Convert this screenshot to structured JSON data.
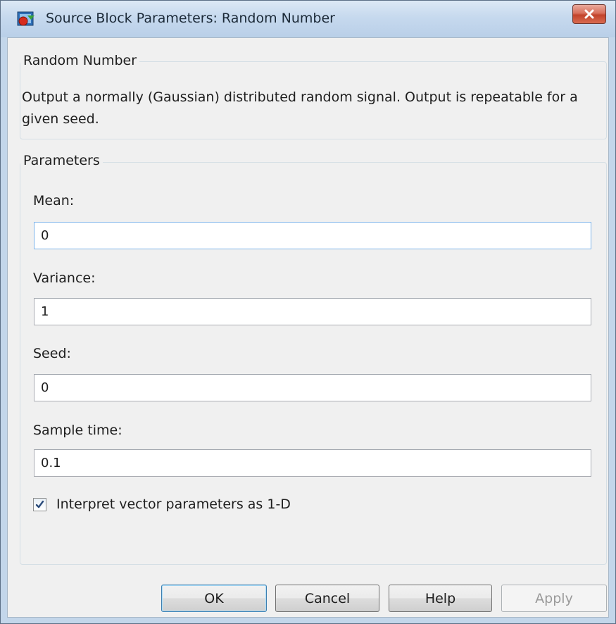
{
  "window": {
    "title": "Source Block Parameters: Random Number"
  },
  "description_group": {
    "title": "Random Number",
    "text": "Output a normally (Gaussian) distributed random signal.  Output is repeatable for a given seed."
  },
  "parameters_group": {
    "title": "Parameters",
    "fields": [
      {
        "label": "Mean:",
        "value": "0"
      },
      {
        "label": "Variance:",
        "value": "1"
      },
      {
        "label": "Seed:",
        "value": "0"
      },
      {
        "label": "Sample time:",
        "value": "0.1"
      }
    ],
    "checkbox": {
      "label": "Interpret vector parameters as 1-D",
      "checked": true
    }
  },
  "buttons": {
    "ok": "OK",
    "cancel": "Cancel",
    "help": "Help",
    "apply": "Apply"
  },
  "icons": {
    "app": "simulink-block-icon",
    "close": "close-icon",
    "check": "checkmark-icon"
  }
}
